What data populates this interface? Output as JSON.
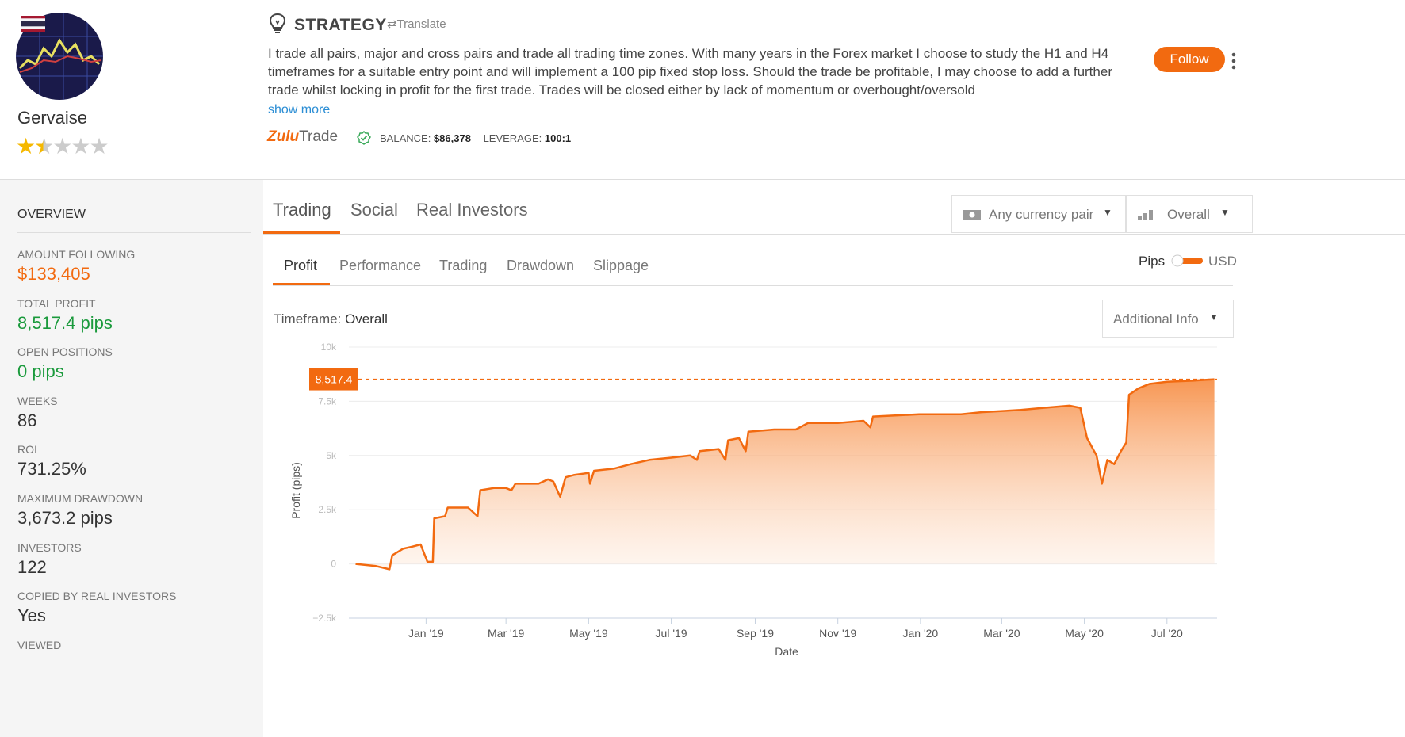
{
  "profile": {
    "name": "Gervaise",
    "rating": 2.5,
    "max_rating": 5
  },
  "strategy": {
    "title": "STRATEGY",
    "translate_label": "Translate",
    "text": "I trade all pairs, major and cross pairs and trade all trading time zones. With many years in the Forex market I choose to study the H1 and H4 timeframes for a suitable entry point and will implement a 100 pip fixed stop loss. Should the trade be profitable, I may choose to add a further trade whilst locking in profit for the first trade. Trades will be closed either by lack of momentum or overbought/oversold",
    "show_more": "show more",
    "brand_zulu": "Zulu",
    "brand_trade": "Trade",
    "balance_label": "BALANCE:",
    "balance_value": "$86,378",
    "leverage_label": "LEVERAGE:",
    "leverage_value": "100:1",
    "follow_label": "Follow"
  },
  "overview": {
    "title": "OVERVIEW",
    "stats": [
      {
        "label": "AMOUNT FOLLOWING",
        "value": "$133,405",
        "color": "#f26a10"
      },
      {
        "label": "TOTAL PROFIT",
        "value": "8,517.4 pips",
        "color": "#1a9a3c"
      },
      {
        "label": "OPEN POSITIONS",
        "value": "0 pips",
        "color": "#1a9a3c"
      },
      {
        "label": "WEEKS",
        "value": "86",
        "color": "#333333"
      },
      {
        "label": "ROI",
        "value": "731.25%",
        "color": "#333333"
      },
      {
        "label": "MAXIMUM DRAWDOWN",
        "value": "3,673.2 pips",
        "color": "#333333"
      },
      {
        "label": "INVESTORS",
        "value": "122",
        "color": "#333333"
      },
      {
        "label": "COPIED BY REAL INVESTORS",
        "value": "Yes",
        "color": "#333333"
      },
      {
        "label": "VIEWED",
        "value": "",
        "color": "#333333"
      }
    ]
  },
  "tabs": {
    "main": [
      "Trading",
      "Social",
      "Real Investors"
    ],
    "sub": [
      "Profit",
      "Performance",
      "Trading",
      "Drawdown",
      "Slippage"
    ],
    "currency_select": "Any currency pair",
    "period_select": "Overall",
    "pips_label": "Pips",
    "usd_label": "USD",
    "timeframe_label": "Timeframe:",
    "timeframe_value": "Overall",
    "additional_info": "Additional Info"
  },
  "colors": {
    "accent": "#f26a10",
    "profit_green": "#1a9a3c",
    "link_blue": "#2a8dd4"
  },
  "chart_data": {
    "type": "area",
    "ylabel": "Profit (pips)",
    "xlabel": "Date",
    "ylim": [
      -2500,
      10000
    ],
    "y_ticks": [
      {
        "v": 10000,
        "label": "10k"
      },
      {
        "v": 7500,
        "label": "7.5k"
      },
      {
        "v": 5000,
        "label": "5k"
      },
      {
        "v": 2500,
        "label": "2.5k"
      },
      {
        "v": 0,
        "label": "0"
      },
      {
        "v": -2500,
        "label": "−2.5k"
      }
    ],
    "x_start": "2018-11-05",
    "x_end": "2020-08-07",
    "x_ticks": [
      {
        "date": "2019-01-01",
        "label": "Jan '19"
      },
      {
        "date": "2019-03-01",
        "label": "Mar '19"
      },
      {
        "date": "2019-05-01",
        "label": "May '19"
      },
      {
        "date": "2019-07-01",
        "label": "Jul '19"
      },
      {
        "date": "2019-09-01",
        "label": "Sep '19"
      },
      {
        "date": "2019-11-01",
        "label": "Nov '19"
      },
      {
        "date": "2020-01-01",
        "label": "Jan '20"
      },
      {
        "date": "2020-03-01",
        "label": "Mar '20"
      },
      {
        "date": "2020-05-01",
        "label": "May '20"
      },
      {
        "date": "2020-07-01",
        "label": "Jul '20"
      }
    ],
    "current_value": 8517.4,
    "current_label": "8,517.4",
    "series": [
      {
        "values": [
          [
            "2018-11-10",
            0
          ],
          [
            "2018-11-25",
            -100
          ],
          [
            "2018-12-05",
            -250
          ],
          [
            "2018-12-07",
            400
          ],
          [
            "2018-12-15",
            700
          ],
          [
            "2018-12-22",
            800
          ],
          [
            "2018-12-28",
            900
          ],
          [
            "2019-01-02",
            100
          ],
          [
            "2019-01-06",
            100
          ],
          [
            "2019-01-07",
            2100
          ],
          [
            "2019-01-15",
            2200
          ],
          [
            "2019-01-17",
            2600
          ],
          [
            "2019-02-01",
            2600
          ],
          [
            "2019-02-08",
            2200
          ],
          [
            "2019-02-10",
            3400
          ],
          [
            "2019-02-20",
            3500
          ],
          [
            "2019-03-01",
            3500
          ],
          [
            "2019-03-05",
            3400
          ],
          [
            "2019-03-08",
            3700
          ],
          [
            "2019-03-25",
            3700
          ],
          [
            "2019-04-01",
            3900
          ],
          [
            "2019-04-05",
            3800
          ],
          [
            "2019-04-10",
            3100
          ],
          [
            "2019-04-14",
            4000
          ],
          [
            "2019-04-20",
            4100
          ],
          [
            "2019-05-01",
            4200
          ],
          [
            "2019-05-02",
            3700
          ],
          [
            "2019-05-05",
            4300
          ],
          [
            "2019-05-20",
            4400
          ],
          [
            "2019-06-01",
            4600
          ],
          [
            "2019-06-15",
            4800
          ],
          [
            "2019-07-01",
            4900
          ],
          [
            "2019-07-15",
            5000
          ],
          [
            "2019-07-20",
            4800
          ],
          [
            "2019-07-22",
            5200
          ],
          [
            "2019-08-05",
            5300
          ],
          [
            "2019-08-10",
            4800
          ],
          [
            "2019-08-12",
            5700
          ],
          [
            "2019-08-20",
            5800
          ],
          [
            "2019-08-25",
            5200
          ],
          [
            "2019-08-27",
            6100
          ],
          [
            "2019-09-15",
            6200
          ],
          [
            "2019-10-01",
            6200
          ],
          [
            "2019-10-10",
            6500
          ],
          [
            "2019-11-01",
            6500
          ],
          [
            "2019-11-20",
            6600
          ],
          [
            "2019-11-25",
            6300
          ],
          [
            "2019-11-27",
            6800
          ],
          [
            "2019-12-31",
            6900
          ],
          [
            "2020-01-31",
            6900
          ],
          [
            "2020-02-15",
            7000
          ],
          [
            "2020-03-15",
            7100
          ],
          [
            "2020-04-01",
            7200
          ],
          [
            "2020-04-20",
            7300
          ],
          [
            "2020-04-28",
            7200
          ],
          [
            "2020-05-03",
            5800
          ],
          [
            "2020-05-10",
            5000
          ],
          [
            "2020-05-14",
            3700
          ],
          [
            "2020-05-18",
            4800
          ],
          [
            "2020-05-23",
            4600
          ],
          [
            "2020-05-28",
            5200
          ],
          [
            "2020-06-01",
            5600
          ],
          [
            "2020-06-03",
            7800
          ],
          [
            "2020-06-10",
            8100
          ],
          [
            "2020-06-18",
            8300
          ],
          [
            "2020-07-01",
            8400
          ],
          [
            "2020-07-20",
            8450
          ],
          [
            "2020-08-05",
            8517.4
          ]
        ]
      }
    ]
  }
}
